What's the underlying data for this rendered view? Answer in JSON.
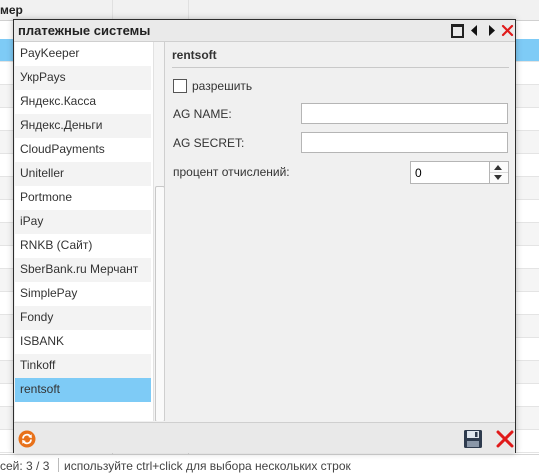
{
  "background": {
    "header_label": "мер",
    "status": {
      "count": "сей: 3 / 3",
      "hint": "используйте ctrl+click для выбора нескольких строк"
    }
  },
  "dialog": {
    "title": "платежные системы",
    "titlebar_icons": [
      "maximize-icon",
      "arrow-left-icon",
      "arrow-right-icon",
      "close-icon"
    ],
    "list": {
      "selected": "rentsoft",
      "items": [
        {
          "label": "PayKeeper"
        },
        {
          "label": "УкрPays"
        },
        {
          "label": "Яндекс.Касса"
        },
        {
          "label": "Яндекс.Деньги"
        },
        {
          "label": "CloudPayments"
        },
        {
          "label": "Uniteller"
        },
        {
          "label": "Portmone"
        },
        {
          "label": "iPay"
        },
        {
          "label": "RNKB (Сайт)"
        },
        {
          "label": "SberBank.ru Мерчант"
        },
        {
          "label": "SimplePay"
        },
        {
          "label": "Fondy"
        },
        {
          "label": "ISBANK"
        },
        {
          "label": "Tinkoff"
        },
        {
          "label": "rentsoft"
        }
      ]
    },
    "detail": {
      "title": "rentsoft",
      "allow_label": "разрешить",
      "allow_checked": false,
      "ag_name_label": "AG NAME:",
      "ag_name_value": "",
      "ag_secret_label": "AG SECRET:",
      "ag_secret_value": "",
      "percent_label": "процент отчислений:",
      "percent_value": "0"
    },
    "footer_icons": [
      "refresh-icon",
      "save-icon",
      "cancel-icon"
    ]
  },
  "colors": {
    "selection": "#7ecbf6",
    "close_red": "#e01a1a",
    "refresh_orange": "#e8711a"
  }
}
